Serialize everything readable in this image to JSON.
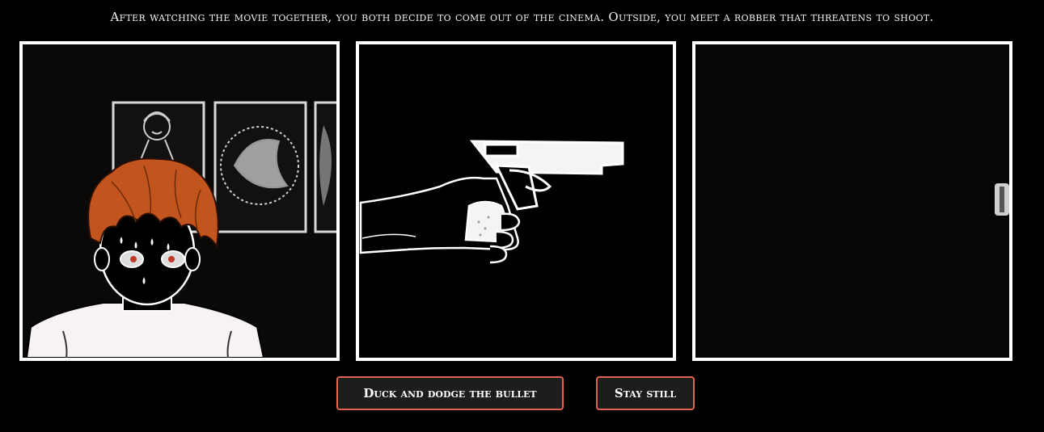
{
  "story": {
    "narration": "After watching the movie together, you both decide to come out of the cinema. Outside, you meet a robber that threatens to shoot."
  },
  "panels": [
    {
      "content": "scared boy with orange hair in front of movie posters"
    },
    {
      "content": "hand holding a pistol"
    },
    {
      "content": "dark panel with bullet edge"
    }
  ],
  "choices": {
    "duck_label": "Duck and dodge the bullet",
    "still_label": "Stay still"
  },
  "colors": {
    "background": "#000000",
    "panel_border": "#ffffff",
    "button_border": "#e0654f",
    "button_fill": "#1d1d1d",
    "hair": "#c2551e"
  }
}
